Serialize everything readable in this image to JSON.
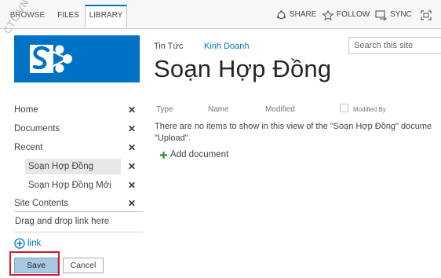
{
  "ribbon": {
    "tabs": [
      "BROWSE",
      "FILES",
      "LIBRARY"
    ],
    "actions": {
      "share": "SHARE",
      "follow": "FOLLOW",
      "sync": "SYNC"
    }
  },
  "watermark": "CTL.VN",
  "top_nav": [
    "Tin Tức",
    "Kinh Doanh"
  ],
  "search": {
    "placeholder": "Search this site"
  },
  "page_title": "Soạn Hợp Đồng",
  "quick_launch": {
    "items": [
      {
        "label": "Home",
        "close": "✕"
      },
      {
        "label": "Documents",
        "close": "✕"
      },
      {
        "label": "Recent",
        "close": "✕"
      },
      {
        "label": "Soạn Hợp Đồng",
        "close": "✕"
      },
      {
        "label": "Soạn Hợp Đồng Mới",
        "close": "✕"
      },
      {
        "label": "Site Contents",
        "close": "✕"
      }
    ],
    "drag_drop_hint": "Drag and drop link here",
    "add_link": "link",
    "save": "Save",
    "cancel": "Cancel"
  },
  "list": {
    "columns": [
      "Type",
      "Name",
      "Modified",
      "Modified By"
    ],
    "empty_line1": "There are no items to show in this view of the \"Soạn Hợp Đồng\" docume",
    "empty_line2": "\"Upload\".",
    "add_document": "Add document"
  },
  "colors": {
    "brand": "#0072c6",
    "highlight": "#d11a2a",
    "save_button": "#a9c8e3"
  }
}
